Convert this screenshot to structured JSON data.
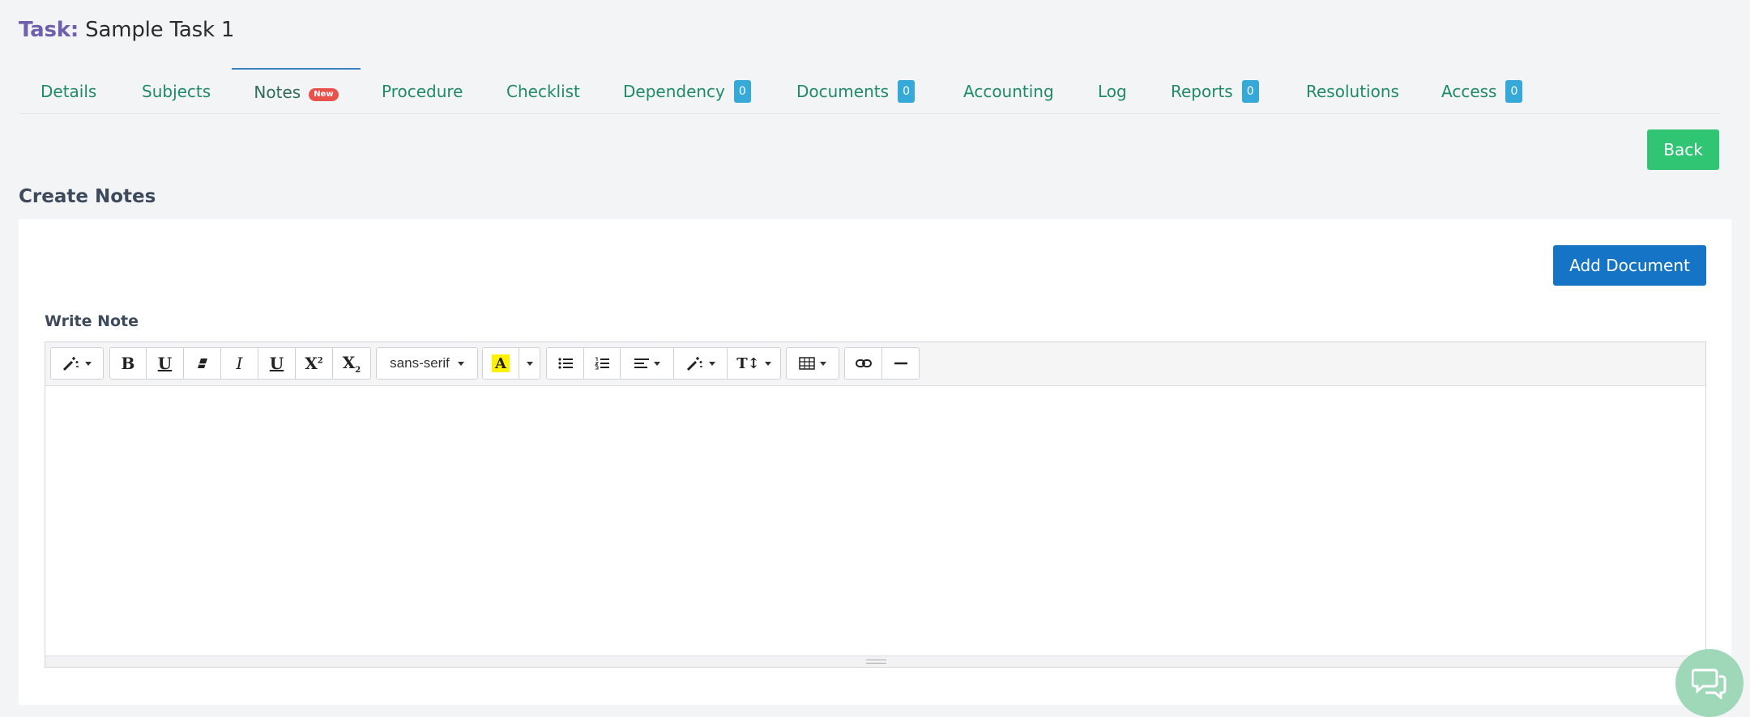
{
  "header": {
    "task_label": "Task:",
    "task_name": "Sample Task 1"
  },
  "tabs": [
    {
      "label": "Details"
    },
    {
      "label": "Subjects"
    },
    {
      "label": "Notes",
      "badge": "New",
      "active": true
    },
    {
      "label": "Procedure"
    },
    {
      "label": "Checklist"
    },
    {
      "label": "Dependency",
      "count": "0"
    },
    {
      "label": "Documents",
      "count": "0"
    },
    {
      "label": "Accounting"
    },
    {
      "label": "Log"
    },
    {
      "label": "Reports",
      "count": "0"
    },
    {
      "label": "Resolutions"
    },
    {
      "label": "Access",
      "count": "0"
    }
  ],
  "actions": {
    "back_label": "Back",
    "add_document_label": "Add Document"
  },
  "section": {
    "title": "Create Notes",
    "write_label": "Write Note"
  },
  "editor": {
    "font_family_value": "sans-serif",
    "toolbar_icons": [
      "style-magic-icon",
      "bold-icon",
      "underline-icon",
      "eraser-icon",
      "italic-icon",
      "underline-icon",
      "superscript-icon",
      "subscript-icon",
      "font-family-select",
      "text-color-icon",
      "unordered-list-icon",
      "ordered-list-icon",
      "align-icon",
      "magic-icon",
      "text-size-icon",
      "table-icon",
      "link-icon",
      "horizontal-rule-icon"
    ],
    "content": ""
  },
  "colors": {
    "tab_text": "#1f8a66",
    "task_label": "#6f5fad",
    "back_button": "#2fc573",
    "add_button": "#1574c5",
    "badge_count": "#36a9d9",
    "badge_new": "#e8524a"
  }
}
